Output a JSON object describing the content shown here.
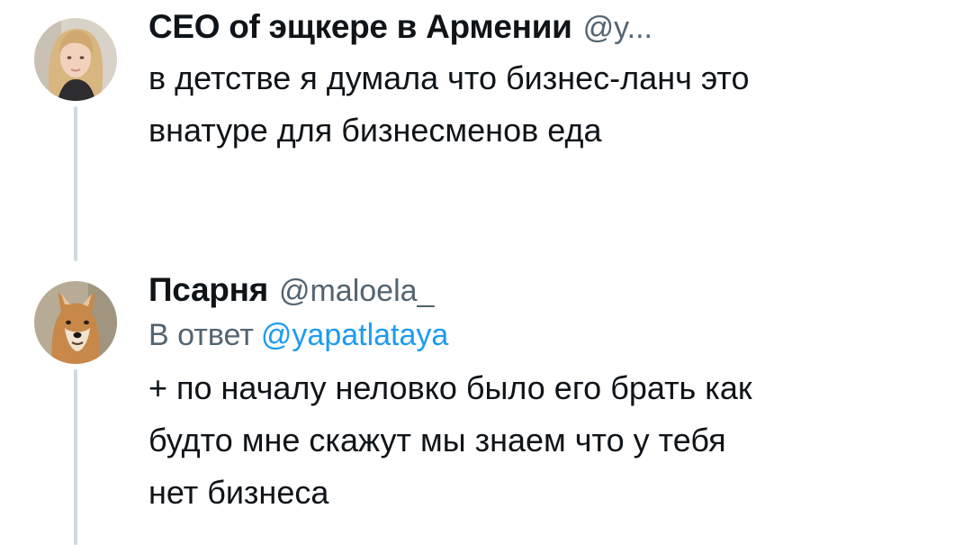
{
  "thread": [
    {
      "author": {
        "display_name": "CEO of эщкере в Армении",
        "handle": "@y..."
      },
      "avatar_icon": "user-avatar-blonde-woman",
      "text_lines": [
        "в детстве я думала что бизнес-ланч это",
        "внатуре для бизнесменов еда"
      ]
    },
    {
      "author": {
        "display_name": "Псарня",
        "handle": "@maloela_"
      },
      "avatar_icon": "user-avatar-shiba-dog",
      "reply_to": {
        "prefix": "В ответ",
        "handle": "@yapatlataya"
      },
      "text_lines": [
        "+ по началу неловко было его брать как",
        "будто мне скажут мы знаем что у тебя",
        "нет бизнеса"
      ]
    }
  ],
  "colors": {
    "text": "#0f1419",
    "secondary": "#536471",
    "link": "#1d9bf0",
    "thread_line": "#cfd9de"
  }
}
